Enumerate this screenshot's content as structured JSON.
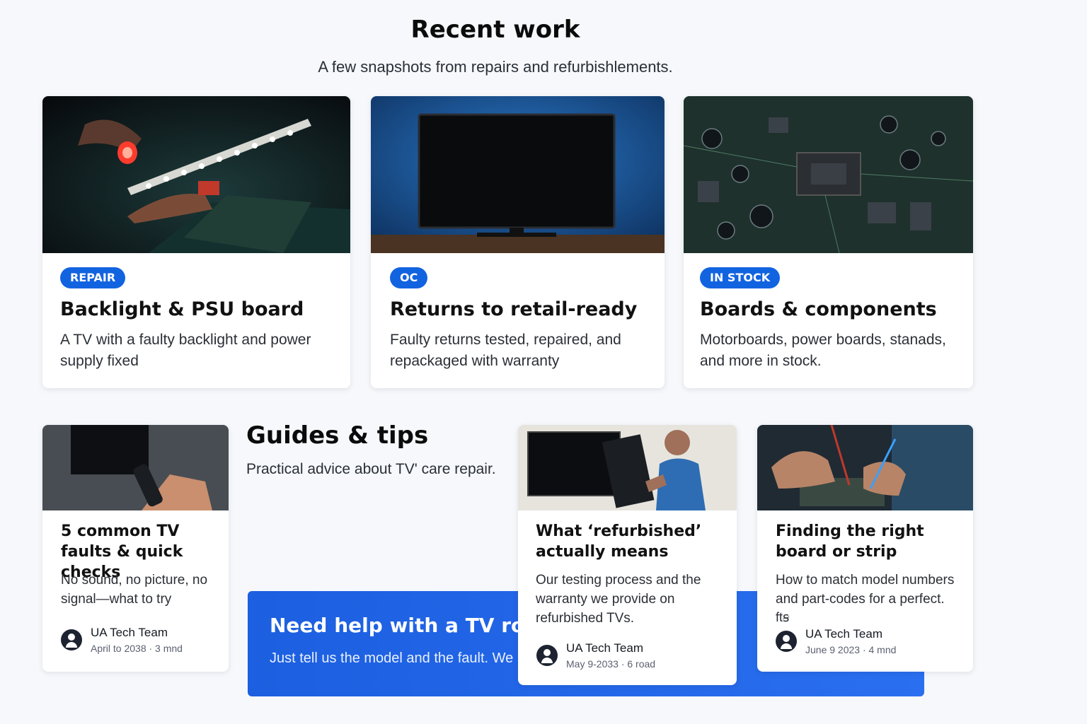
{
  "recent_work": {
    "title": "Recent work",
    "subtitle": "A few snapshots from repairs and refurbishlements.",
    "cards": [
      {
        "badge": "REPAIR",
        "title": "Backlight & PSU board",
        "text": "A TV with a faulty backlight and power supply fixed"
      },
      {
        "badge": "OC",
        "title": "Returns to retail-ready",
        "text": "Faulty returns tested, repaired, and repackaged with warranty"
      },
      {
        "badge": "IN STOCK",
        "title": "Boards & components",
        "text": "Motorboards, power boards, stanads, and more in stock."
      }
    ]
  },
  "guides": {
    "title": "Guides & tips",
    "subtitle": "Practical advice about TV' care repair.",
    "cards": [
      {
        "title": "5 common TV faults & quick checks",
        "text": "No sound, no picture, no signal—what to try",
        "author": "UA Tech Team",
        "meta": "April to 2038 · 3 mnd"
      },
      {
        "title": "What ‘refurbished’ actually means",
        "text": "Our testing process and the warranty we provide on refurbished TVs.",
        "author": "UA Tech Team",
        "meta": "May 9-2033 · 6 road"
      },
      {
        "title": "Finding the right board or strip",
        "text": "How to match model numbers and part-codes for a perfect.",
        "extra": "ftꞩ",
        "author": "UA Tech Team",
        "meta": "June 9 2023 · 4 mnd"
      }
    ]
  },
  "cta": {
    "title": "Need help with a TV roday?",
    "text": "Just tell us the model and the fault. We"
  },
  "colors": {
    "accent": "#1263e0",
    "cta_bg": "#1c5fe0",
    "page_bg": "#f6f8fb"
  },
  "icons": [
    "avatar-icon"
  ]
}
